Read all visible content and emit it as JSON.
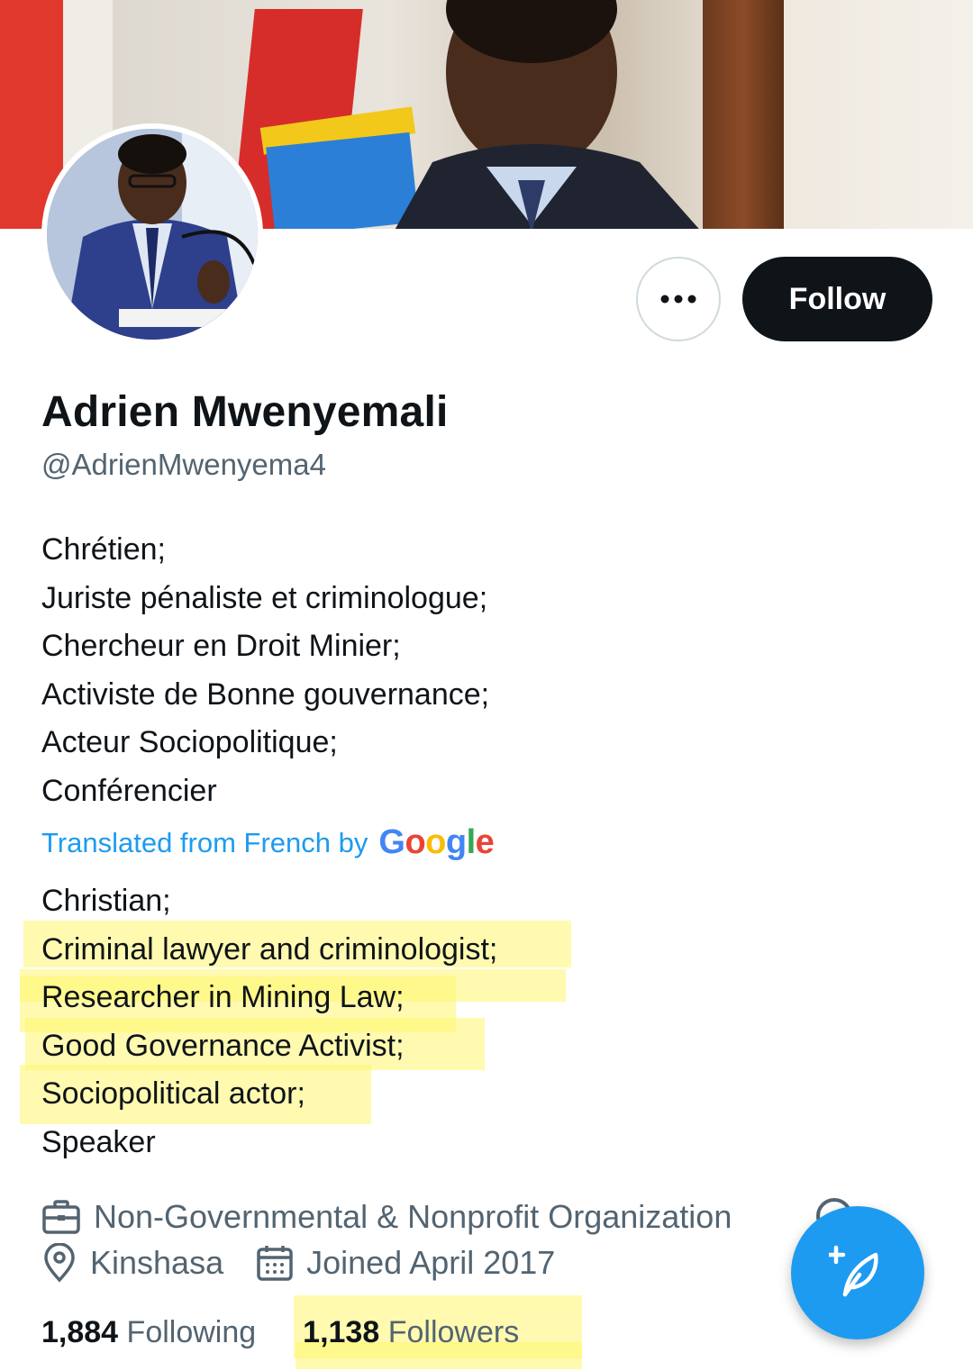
{
  "profile": {
    "name": "Adrien Mwenyemali",
    "handle": "@AdrienMwenyema4"
  },
  "actions": {
    "more_label": "•••",
    "follow_label": "Follow"
  },
  "bio_original": [
    "Chrétien;",
    "Juriste pénaliste et criminologue;",
    "Chercheur en Droit Minier;",
    "Activiste de Bonne gouvernance;",
    "Acteur Sociopolitique;",
    "Conférencier"
  ],
  "translation": {
    "label": "Translated from French by",
    "provider": "Google"
  },
  "bio_translated": [
    "Christian;",
    "Criminal lawyer and criminologist;",
    "Researcher in Mining Law;",
    "Good Governance Activist;",
    "Sociopolitical actor;",
    "Speaker"
  ],
  "meta": {
    "category": "Non-Governmental & Nonprofit Organization",
    "location": "Kinshasa",
    "joined": "Joined April 2017"
  },
  "stats": {
    "following_count": "1,884",
    "following_label": "Following",
    "followers_count": "1,138",
    "followers_label": "Followers"
  },
  "colors": {
    "accent": "#1d9bf0",
    "text": "#0f1419",
    "secondary": "#536471",
    "highlight": "#fff56e"
  },
  "icons": {
    "more": "more-dots-icon",
    "category": "briefcase-icon",
    "location": "location-pin-icon",
    "joined": "calendar-icon",
    "compose": "compose-tweet-icon"
  }
}
